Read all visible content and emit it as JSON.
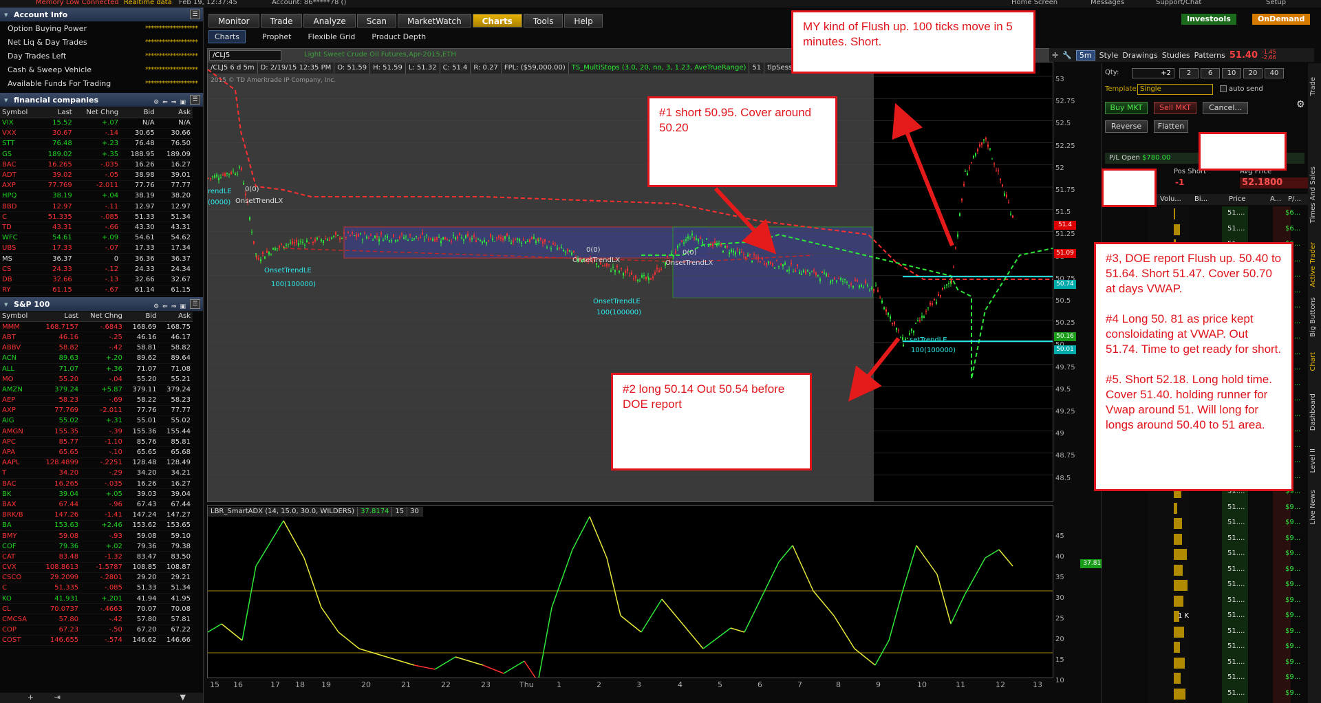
{
  "topbar": {
    "date": "Feb 19, 12:37:45",
    "status": "Memory Low  Connected",
    "realtime": "Realtime data",
    "account": "Account: 86*****78 ()",
    "home": "Home Screen",
    "messages": "Messages",
    "support": "Support/Chat",
    "setup": "Setup"
  },
  "account_info": {
    "title": "Account Info",
    "rows": [
      "Option Buying Power",
      "Net Liq & Day Trades",
      "Day Trades Left",
      "Cash & Sweep Vehicle",
      "Available Funds For Trading"
    ],
    "masked": "*******************"
  },
  "watchlist1": {
    "title": "financial companies",
    "headers": [
      "Symbol",
      "Last",
      "Net Chng",
      "Bid",
      "Ask"
    ],
    "rows": [
      [
        "VIX",
        "15.52",
        "+.07",
        "N/A",
        "N/A"
      ],
      [
        "VXX",
        "30.67",
        "-.14",
        "30.65",
        "30.66"
      ],
      [
        "STT",
        "76.48",
        "+.23",
        "76.48",
        "76.50"
      ],
      [
        "GS",
        "189.02",
        "+.35",
        "188.95",
        "189.09"
      ],
      [
        "BAC",
        "16.265",
        "-.035",
        "16.26",
        "16.27"
      ],
      [
        "ADT",
        "39.02",
        "-.05",
        "38.98",
        "39.01"
      ],
      [
        "AXP",
        "77.769",
        "-2.011",
        "77.76",
        "77.77"
      ],
      [
        "HPQ",
        "38.19",
        "+.04",
        "38.19",
        "38.20"
      ],
      [
        "BBD",
        "12.97",
        "-.11",
        "12.97",
        "12.97"
      ],
      [
        "C",
        "51.335",
        "-.085",
        "51.33",
        "51.34"
      ],
      [
        "TD",
        "43.31",
        "-.66",
        "43.30",
        "43.31"
      ],
      [
        "WFC",
        "54.61",
        "+.09",
        "54.61",
        "54.62"
      ],
      [
        "UBS",
        "17.33",
        "-.07",
        "17.33",
        "17.34"
      ],
      [
        "MS",
        "36.37",
        "0",
        "36.36",
        "36.37"
      ],
      [
        "CS",
        "24.33",
        "-.12",
        "24.33",
        "24.34"
      ],
      [
        "DB",
        "32.66",
        "-.13",
        "32.66",
        "32.67"
      ],
      [
        "RY",
        "61.15",
        "-.67",
        "61.14",
        "61.15"
      ]
    ]
  },
  "watchlist2": {
    "title": "S&P 100",
    "headers": [
      "Symbol",
      "Last",
      "Net Chng",
      "Bid",
      "Ask"
    ],
    "rows": [
      [
        "MMM",
        "168.7157",
        "-.6843",
        "168.69",
        "168.75"
      ],
      [
        "ABT",
        "46.16",
        "-.25",
        "46.16",
        "46.17"
      ],
      [
        "ABBV",
        "58.82",
        "-.42",
        "58.81",
        "58.82"
      ],
      [
        "ACN",
        "89.63",
        "+.20",
        "89.62",
        "89.64"
      ],
      [
        "ALL",
        "71.07",
        "+.36",
        "71.07",
        "71.08"
      ],
      [
        "MO",
        "55.20",
        "-.04",
        "55.20",
        "55.21"
      ],
      [
        "AMZN",
        "379.24",
        "+5.87",
        "379.11",
        "379.24"
      ],
      [
        "AEP",
        "58.23",
        "-.69",
        "58.22",
        "58.23"
      ],
      [
        "AXP",
        "77.769",
        "-2.011",
        "77.76",
        "77.77"
      ],
      [
        "AIG",
        "55.02",
        "+.31",
        "55.01",
        "55.02"
      ],
      [
        "AMGN",
        "155.35",
        "-.39",
        "155.36",
        "155.44"
      ],
      [
        "APC",
        "85.77",
        "-1.10",
        "85.76",
        "85.81"
      ],
      [
        "APA",
        "65.65",
        "-.10",
        "65.65",
        "65.68"
      ],
      [
        "AAPL",
        "128.4899",
        "-.2251",
        "128.48",
        "128.49"
      ],
      [
        "T",
        "34.20",
        "-.29",
        "34.20",
        "34.21"
      ],
      [
        "BAC",
        "16.265",
        "-.035",
        "16.26",
        "16.27"
      ],
      [
        "BK",
        "39.04",
        "+.05",
        "39.03",
        "39.04"
      ],
      [
        "BAX",
        "67.44",
        "-.96",
        "67.43",
        "67.44"
      ],
      [
        "BRK/B",
        "147.26",
        "-1.41",
        "147.24",
        "147.27"
      ],
      [
        "BA",
        "153.63",
        "+2.46",
        "153.62",
        "153.65"
      ],
      [
        "BMY",
        "59.08",
        "-.93",
        "59.08",
        "59.10"
      ],
      [
        "COF",
        "79.36",
        "+.02",
        "79.36",
        "79.38"
      ],
      [
        "CAT",
        "83.48",
        "-1.32",
        "83.47",
        "83.50"
      ],
      [
        "CVX",
        "108.8613",
        "-1.5787",
        "108.85",
        "108.87"
      ],
      [
        "CSCO",
        "29.2099",
        "-.2801",
        "29.20",
        "29.21"
      ],
      [
        "C",
        "51.335",
        "-.085",
        "51.33",
        "51.34"
      ],
      [
        "KO",
        "41.931",
        "+.201",
        "41.94",
        "41.95"
      ],
      [
        "CL",
        "70.0737",
        "-.4663",
        "70.07",
        "70.08"
      ],
      [
        "CMCSA",
        "57.80",
        "-.42",
        "57.80",
        "57.81"
      ],
      [
        "COP",
        "67.23",
        "-.50",
        "67.20",
        "67.22"
      ],
      [
        "COST",
        "146.655",
        "-.574",
        "146.62",
        "146.66"
      ]
    ]
  },
  "nav_tabs": [
    "Monitor",
    "Trade",
    "Analyze",
    "Scan",
    "MarketWatch",
    "Charts",
    "Tools",
    "Help"
  ],
  "active_tab": "Charts",
  "brand": {
    "investools": "Investools",
    "ondemand": "OnDemand"
  },
  "subnav": [
    "Charts",
    "Prophet",
    "Flexible Grid",
    "Product Depth"
  ],
  "chart": {
    "symbol": "/CLJ5",
    "description": "Light Sweet Crude Oil Futures,Apr-2015,ETH",
    "info": [
      "/CLJ5 6 d 5m",
      "D: 2/19/15 12:35 PM",
      "O: 51.59",
      "H: 51.59",
      "L: 51.32",
      "C: 51.4",
      "R: 0.27",
      "FPL: ($59,000.00)",
      "TS_MultiStops (3.0, 20, no, 3, 1.23, AveTrueRange)",
      "51",
      "tlpSessions"
    ],
    "copyright": "2015 © TD Ameritrade IP Company, Inc.",
    "yticks": [
      "53",
      "52.75",
      "52.5",
      "52.25",
      "52",
      "51.75",
      "51.5",
      "51.25",
      "51",
      "50.75",
      "50.5",
      "50.25",
      "50",
      "49.75",
      "49.5",
      "49.25",
      "49",
      "48.75",
      "48.5"
    ],
    "price_tags": {
      "last": "51.4",
      "red": "51.09",
      "cyan1": "50.74",
      "green": "50.16",
      "cyan2": "50.01"
    },
    "labels": {
      "le1": "rendLE",
      "le1b": "(0000)",
      "lx1": "OnsetTrendLX",
      "zero1": "0(0)",
      "le2": "OnsetTrendLE",
      "le2b": "100(100000)",
      "zero2": "0(0)",
      "lx2": "OnsetTrendLX",
      "zero3": "0(0)",
      "lx3": "OnsetTrendLX",
      "le3": "OnsetTrendLE",
      "le3b": "100(100000)",
      "le4": "setTrendLE",
      "le4b": "100(100000)"
    },
    "lower": {
      "study": "LBR_SmartADX (14, 15.0, 30.0, WILDERS)",
      "value": "37.8174",
      "p1": "15",
      "p2": "30",
      "yticks": [
        "45",
        "40",
        "35",
        "30",
        "25",
        "20",
        "15",
        "10"
      ],
      "tag": "37.8174"
    },
    "xticks": [
      "15",
      "16",
      "17",
      "18",
      "19",
      "20",
      "21",
      "22",
      "23",
      "Thu",
      "1",
      "2",
      "3",
      "4",
      "5",
      "6",
      "7",
      "8",
      "9",
      "10",
      "11",
      "12",
      "13"
    ]
  },
  "toolbar": {
    "timeframe": "5m",
    "style": "Style",
    "drawings": "Drawings",
    "studies": "Studies",
    "patterns": "Patterns",
    "price": "51.40",
    "chg1": "-1.45",
    "chg2": "-2.66"
  },
  "active_trader": {
    "qty_label": "Qty:",
    "qty_value": "+2",
    "qty_buttons": [
      "2",
      "6",
      "10",
      "20",
      "40"
    ],
    "template_label": "Template:",
    "template_value": "Single",
    "auto_send": "auto send",
    "buy": "Buy MKT",
    "sell": "Sell MKT",
    "cancel": "Cancel...",
    "reverse": "Reverse",
    "flatten": "Flatten",
    "pl_open": "P/L Open",
    "pl_value": "$780.00",
    "pos_label": "Pos Short",
    "pos_value": "-1",
    "avg_label": "Avg Price",
    "avg_value": "52.1800",
    "ladder_headers": [
      "Volu...",
      "Bi...",
      "Price",
      "A...",
      "P/..."
    ],
    "ladder_rows": [
      {
        "price": "51....",
        "pl": "$6..."
      },
      {
        "price": "51....",
        "pl": "$6..."
      },
      {
        "price": "51....",
        "pl": "$6..."
      },
      {
        "price": "51....",
        "pl": "$6..."
      },
      {
        "price": "51....",
        "pl": "$7..."
      },
      {
        "price": "51....",
        "pl": "$7..."
      },
      {
        "price": "51....",
        "pl": "$7..."
      },
      {
        "price": "51....",
        "pl": "$7..."
      },
      {
        "price": "51....",
        "pl": "$7..."
      },
      {
        "price": "51....",
        "pl": "$7..."
      },
      {
        "price": "51....",
        "pl": "$8..."
      },
      {
        "price": "51....",
        "pl": "$8..."
      },
      {
        "price": "51....",
        "pl": "$8..."
      },
      {
        "price": "51....",
        "pl": "$8..."
      },
      {
        "price": "51....",
        "pl": "$8..."
      },
      {
        "price": "51....",
        "pl": "$8..."
      },
      {
        "price": "51....",
        "pl": "$8..."
      },
      {
        "price": "51....",
        "pl": "$8..."
      },
      {
        "price": "51....",
        "pl": "$9..."
      },
      {
        "price": "51....",
        "pl": "$9..."
      },
      {
        "price": "51....",
        "pl": "$9..."
      },
      {
        "price": "51....",
        "pl": "$9..."
      },
      {
        "price": "51....",
        "pl": "$9..."
      },
      {
        "price": "51....",
        "pl": "$9..."
      },
      {
        "price": "51....",
        "pl": "$9..."
      },
      {
        "price": "51....",
        "pl": "$9..."
      },
      {
        "price": "51....",
        "pl": "$9..."
      },
      {
        "price": "51....",
        "pl": "$9..."
      },
      {
        "price": "51....",
        "pl": "$9..."
      },
      {
        "price": "51....",
        "pl": "$9..."
      },
      {
        "price": "51....",
        "pl": "$9..."
      },
      {
        "price": "51....",
        "pl": "$9..."
      }
    ],
    "vol_label": "1 K"
  },
  "side_tabs": [
    "Trade",
    "Times And Sales",
    "Active Trader",
    "Big Buttons",
    "Chart",
    "Dashboard",
    "Level II",
    "Live News"
  ],
  "annotations": {
    "a1": "#1 short 50.95. Cover around 50.20",
    "a2": "#2 long 50.14 Out 50.54 before DOE report",
    "a3": "MY kind of Flush up. 100 ticks move in 5 minutes. Short.",
    "a4": "#3, DOE report Flush up. 50.40 to 51.64. Short 51.47. Cover 50.70 at days VWAP.\n\n#4 Long 50. 81 as price kept consloidating at VWAP. Out 51.74. Time to get ready for short.\n\n#5. Short 52.18. Long hold time. Cover 51.40. holding runner for Vwap around 51.  Will long for longs around 50.40 to 51 area."
  }
}
